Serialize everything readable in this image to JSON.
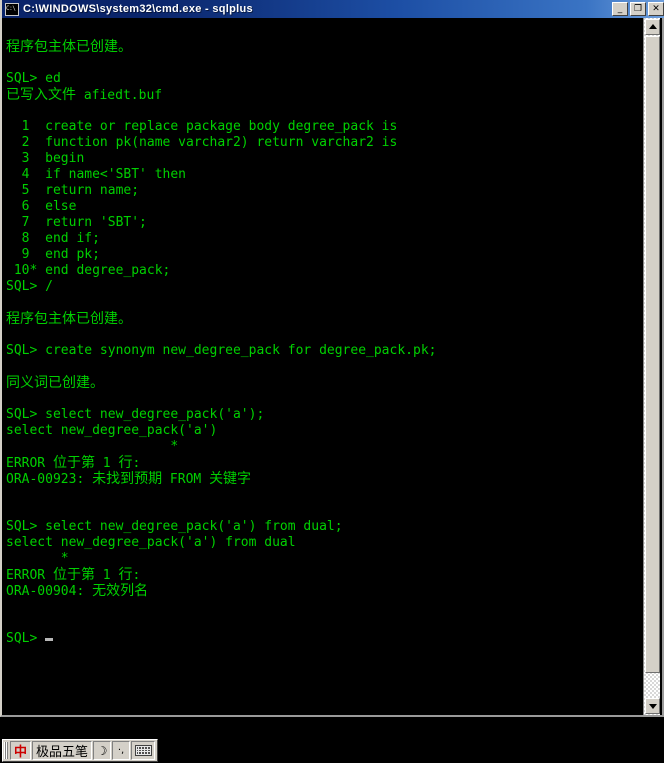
{
  "window": {
    "title": "C:\\WINDOWS\\system32\\cmd.exe - sqlplus",
    "icon": "cmd-icon",
    "buttons": {
      "minimize": "_",
      "restore": "❐",
      "close": "✕"
    }
  },
  "console": {
    "foreground_color": "#00d000",
    "background_color": "#000000",
    "lines": [
      "",
      "程序包主体已创建。",
      "",
      "SQL> ed",
      "已写入文件 afiedt.buf",
      "",
      "  1  create or replace package body degree_pack is",
      "  2  function pk(name varchar2) return varchar2 is",
      "  3  begin",
      "  4  if name<'SBT' then",
      "  5  return name;",
      "  6  else",
      "  7  return 'SBT';",
      "  8  end if;",
      "  9  end pk;",
      " 10* end degree_pack;",
      "SQL> /",
      "",
      "程序包主体已创建。",
      "",
      "SQL> create synonym new_degree_pack for degree_pack.pk;",
      "",
      "同义词已创建。",
      "",
      "SQL> select new_degree_pack('a');",
      "select new_degree_pack('a')",
      "                     *",
      "ERROR 位于第 1 行:",
      "ORA-00923: 未找到预期 FROM 关键字",
      "",
      "",
      "SQL> select new_degree_pack('a') from dual;",
      "select new_degree_pack('a') from dual",
      "       *",
      "ERROR 位于第 1 行:",
      "ORA-00904: 无效列名",
      "",
      "",
      "SQL> "
    ],
    "cursor": "block-cursor"
  },
  "scrollbar": {
    "up_arrow": "scroll-up",
    "down_arrow": "scroll-down",
    "thumb": "scroll-thumb"
  },
  "ime_bar": {
    "status": "中",
    "method": "极品五笔",
    "shape_toggle": "☽",
    "punctuation_toggle": "·,",
    "keyboard": "soft-keyboard"
  }
}
